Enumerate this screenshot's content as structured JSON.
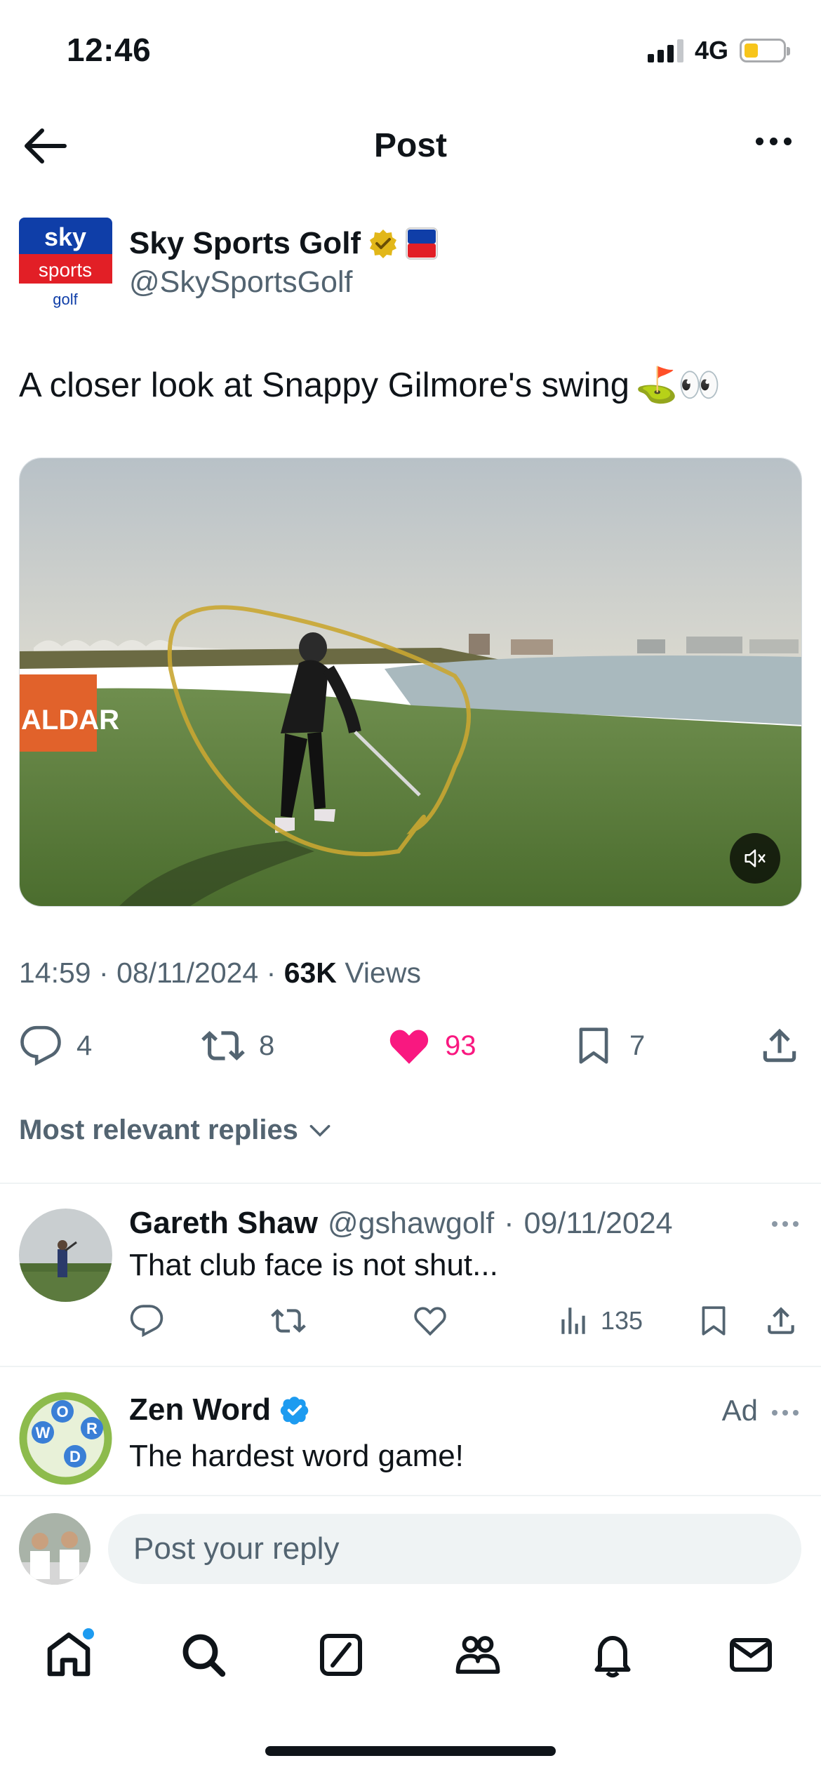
{
  "status_bar": {
    "time": "12:46",
    "network": "4G",
    "battery_level_pct": 35
  },
  "header": {
    "title": "Post"
  },
  "author": {
    "name": "Sky Sports Golf",
    "handle": "@SkySportsGolf",
    "logo_text": {
      "top": "sky",
      "middle": "sports",
      "bottom": "golf"
    },
    "verified": "gold"
  },
  "tweet": {
    "text": "A closer look at Snappy Gilmore's swing",
    "emoji": "⛳👀",
    "media": {
      "type": "video",
      "muted": true,
      "board_text": "ALDAR"
    },
    "time": "14:59",
    "date": "08/11/2024",
    "views_count": "63K",
    "views_label": "Views"
  },
  "actions": {
    "replies": "4",
    "reposts": "8",
    "likes": "93",
    "bookmarks": "7"
  },
  "replies_filter": {
    "label": "Most relevant replies"
  },
  "reply": {
    "name": "Gareth Shaw",
    "handle": "@gshawgolf",
    "date": "09/11/2024",
    "text": "That club face is not shut...",
    "views": "135"
  },
  "ad": {
    "name": "Zen Word",
    "text": "The hardest word game!",
    "ad_label": "Ad",
    "logo_letters": [
      "W",
      "O",
      "R",
      "D"
    ]
  },
  "composer": {
    "placeholder": "Post your reply"
  },
  "bottom_nav": {
    "items": [
      "home-icon",
      "search-icon",
      "grok-icon",
      "communities-icon",
      "notifications-icon",
      "messages-icon"
    ]
  },
  "colors": {
    "like": "#f91880",
    "verified_blue": "#1d9bf0",
    "verified_gold": "#e2b719",
    "muted_text": "#536471"
  }
}
